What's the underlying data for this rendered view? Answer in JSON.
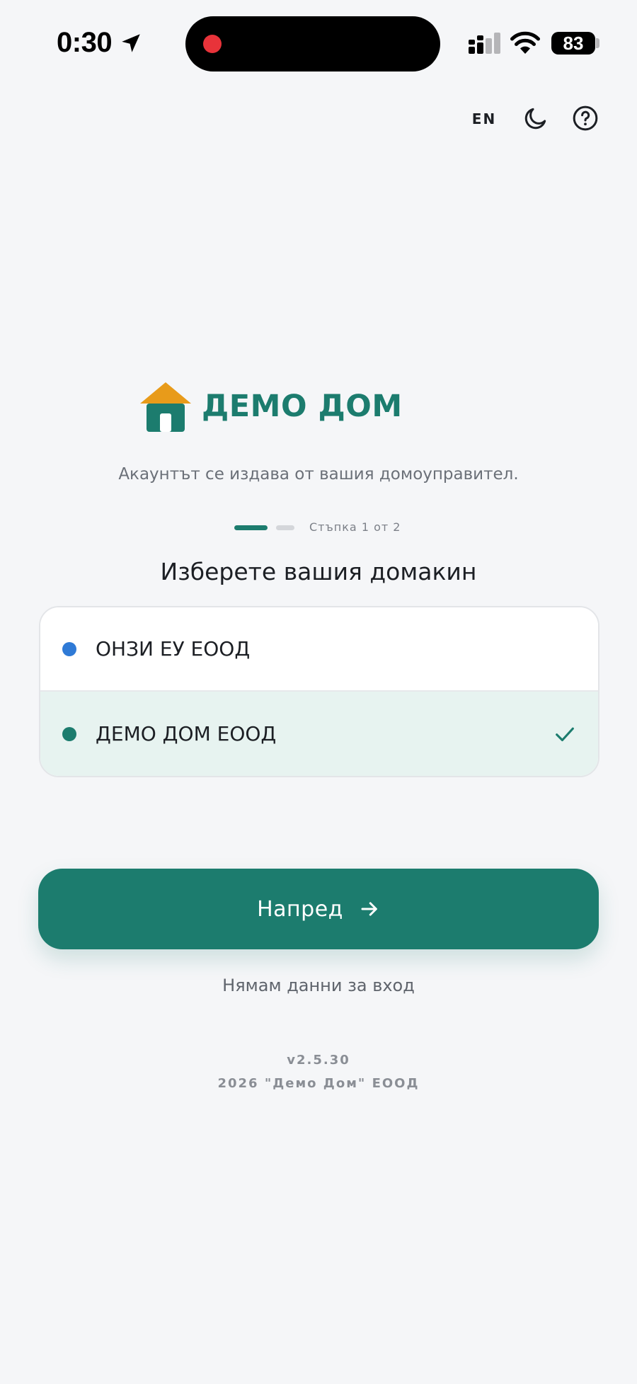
{
  "status_bar": {
    "time": "0:30",
    "battery": "83"
  },
  "top_controls": {
    "language": "EN"
  },
  "brand": {
    "name": "ДЕМО ДОМ",
    "subtitle": "Акаунтът се издава от вашия домоуправител."
  },
  "stepper": {
    "label": "Стъпка 1 от 2",
    "current": 1,
    "total": 2
  },
  "host_select": {
    "title": "Изберете вашия домакин",
    "options": [
      {
        "label": "ОНЗИ ЕУ ЕООД",
        "dot_color": "#2f7ad6",
        "selected": false
      },
      {
        "label": "ДЕМО ДОМ ЕООД",
        "dot_color": "#1c7c6e",
        "selected": true
      }
    ]
  },
  "actions": {
    "next_label": "Напред",
    "no_login_label": "Нямам данни за вход"
  },
  "footer": {
    "version": "v2.5.30",
    "copyright": "2026 \"Демо Дом\" ЕООД"
  },
  "colors": {
    "primary": "#1c7c6e",
    "roof": "#e89b1a",
    "background": "#f5f6f8",
    "selected_row": "#e7f3f0"
  }
}
